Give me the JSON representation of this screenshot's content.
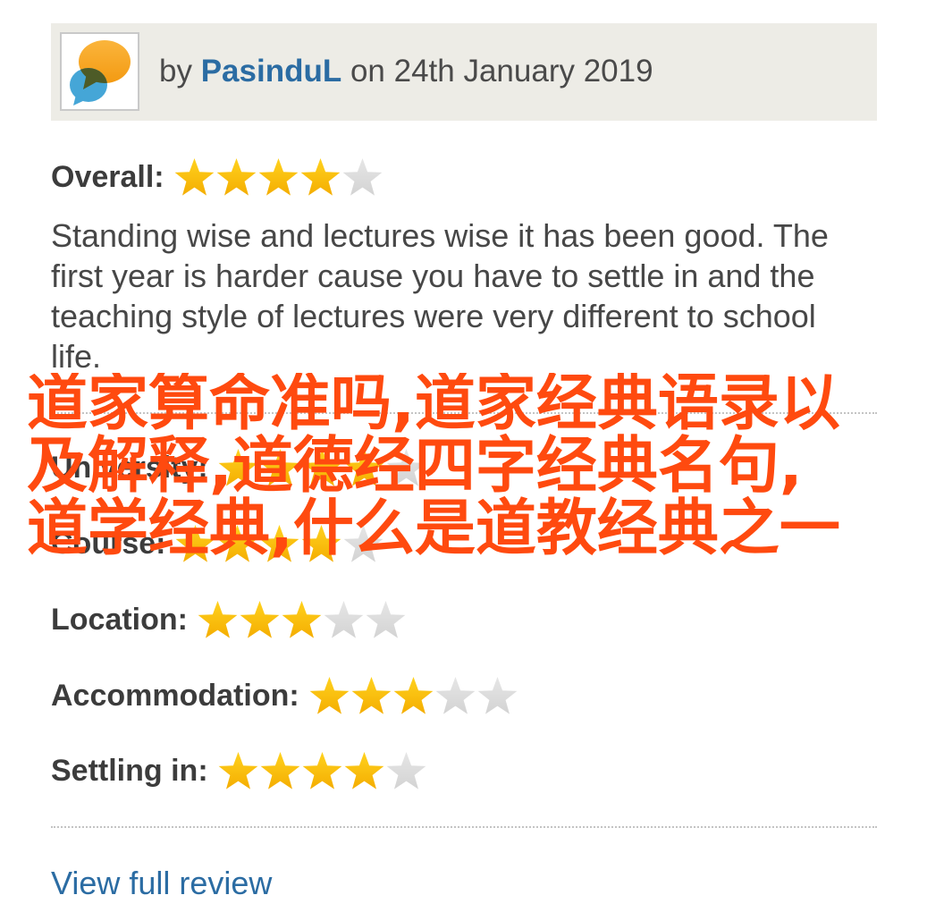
{
  "review": {
    "avatar_icon": "speech-bubbles-logo",
    "by_label": "by",
    "author": "PasinduL",
    "date_text": "on 24th January 2019",
    "overall": {
      "label": "Overall:",
      "rating": 4,
      "max": 5
    },
    "body": "Standing wise and lectures wise it has been good. The first year is harder cause you have to settle in and the teaching style of lectures were very different to school life.",
    "ratings": [
      {
        "label": "University:",
        "rating": 4,
        "max": 5
      },
      {
        "label": "Course:",
        "rating": 4,
        "max": 5
      },
      {
        "label": "Location:",
        "rating": 3,
        "max": 5
      },
      {
        "label": "Accommodation:",
        "rating": 3,
        "max": 5
      },
      {
        "label": "Settling in:",
        "rating": 4,
        "max": 5
      }
    ],
    "link_label": "View full review"
  },
  "overlay": {
    "lines": [
      "道家算命准吗,道家经典语录以",
      "及解释,道德经四字经典名句,",
      "道学经典,什么是道教经典之一"
    ]
  },
  "icons": {
    "star_filled": "star-filled-icon",
    "star_empty": "star-empty-icon"
  },
  "colors": {
    "link": "#2b6ca3",
    "header_bg": "#edece6",
    "star_gold": "#f4ad00",
    "star_gray": "#d3d3d3",
    "overlay_text": "#ff4a0f"
  }
}
